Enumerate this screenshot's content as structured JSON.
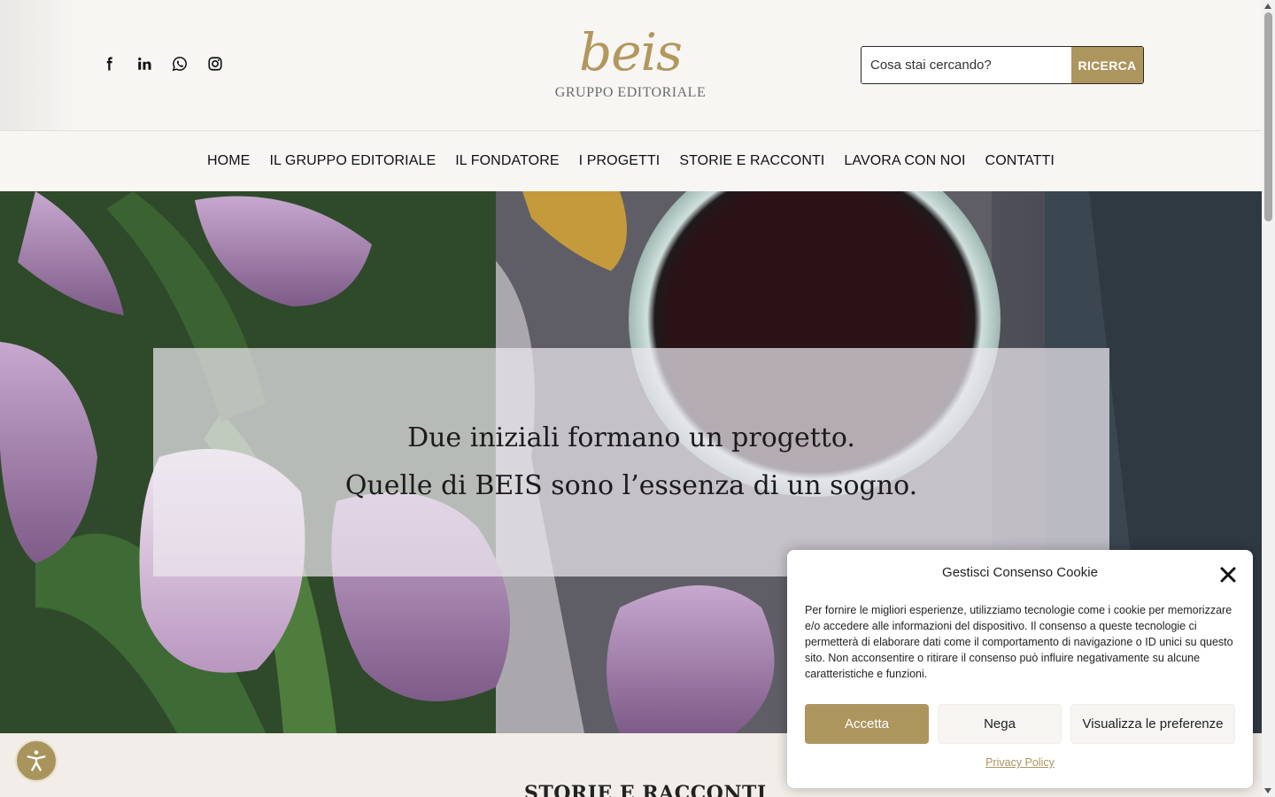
{
  "header": {
    "social": [
      {
        "icon": "facebook-icon"
      },
      {
        "icon": "linkedin-icon"
      },
      {
        "icon": "whatsapp-icon"
      },
      {
        "icon": "instagram-icon"
      }
    ],
    "logo": {
      "script": "beis",
      "subtitle": "GRUPPO EDITORIALE"
    },
    "search": {
      "placeholder": "Cosa stai cercando?",
      "button": "RICERCA"
    }
  },
  "nav": {
    "items": [
      "HOME",
      "IL GRUPPO EDITORIALE",
      "IL FONDATORE",
      "I PROGETTI",
      "STORIE E RACCONTI",
      "LAVORA CON NOI",
      "CONTATTI"
    ]
  },
  "hero": {
    "line1": "Due iniziali formano un progetto.",
    "line2": "Quelle di BEIS sono l’essenza di un sogno."
  },
  "section": {
    "heading": "STORIE E RACCONTI"
  },
  "cookie": {
    "title": "Gestisci Consenso Cookie",
    "message": "Per fornire le migliori esperienze, utilizziamo tecnologie come i cookie per memorizzare e/o accedere alle informazioni del dispositivo. Il consenso a queste tecnologie ci permetterà di elaborare dati come il comportamento di navigazione o ID unici su questo sito. Non acconsentire o ritirare il consenso può influire negativamente su alcune caratteristiche e funzioni.",
    "accept": "Accetta",
    "deny": "Nega",
    "preferences": "Visualizza le preferenze",
    "privacy": "Privacy Policy"
  },
  "colors": {
    "accent": "#ad955e",
    "background": "#f7f6f3"
  }
}
